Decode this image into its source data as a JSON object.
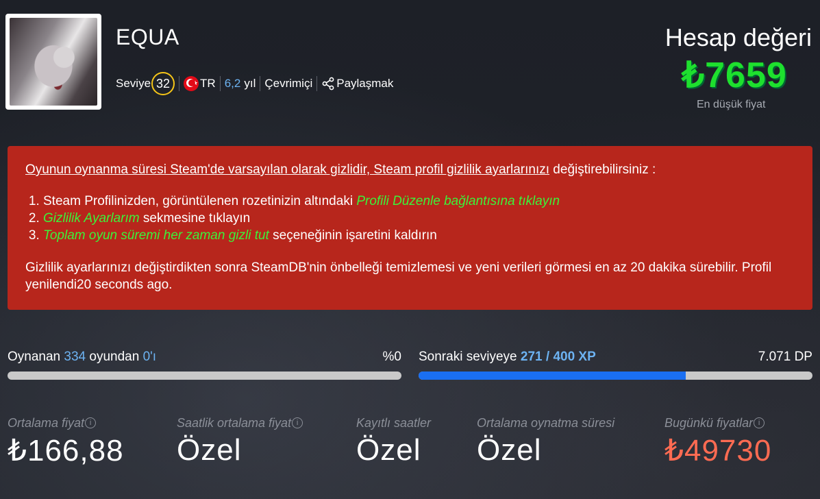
{
  "profile": {
    "username": "EQUA",
    "level_label": "Seviye",
    "level": "32",
    "country_code": "TR",
    "years": "6,2",
    "years_unit": "yıl",
    "status": "Çevrimiçi",
    "share_label": "Paylaşmak",
    "flag_icon": "turkey-flag-icon",
    "share_icon": "share-icon"
  },
  "account_value": {
    "title": "Hesap değeri",
    "price": "₺7659",
    "subtitle": "En düşük fiyat",
    "price_color": "#1ee02e"
  },
  "alert": {
    "background": "#b7261c",
    "heading_link": "Oyunun oynanma süresi Steam'de varsayılan olarak gizlidir, Steam profil gizlilik ayarlarınızı",
    "heading_rest": " değiştirebilirsiniz :",
    "steps": [
      {
        "before": "Steam Profilinizden, görüntülenen rozetinizin altındaki ",
        "highlight": "Profili Düzenle bağlantısına tıklayın",
        "after": ""
      },
      {
        "before": "",
        "highlight": "Gizlilik Ayarlarım",
        "after": " sekmesine tıklayın"
      },
      {
        "before": "",
        "highlight": "Toplam oyun süremi her zaman gizli tut",
        "after": " seçeneğinin işaretini kaldırın"
      }
    ],
    "footer": "Gizlilik ayarlarınızı değiştirdikten sonra SteamDB'nin önbelleği temizlemesi ve yeni verileri görmesi en az 20 dakika sürebilir. Profil yenilendi20 seconds ago."
  },
  "games_progress": {
    "prefix": "Oynanan ",
    "total": "334",
    "middle": " oyundan ",
    "played": "0'ı",
    "percent": "%0",
    "fraction": 0
  },
  "level_progress": {
    "prefix": "Sonraki seviyeye ",
    "xp": "271 / 400 XP",
    "dp": "7.071 DP",
    "fraction": 0.6775
  },
  "stats": [
    {
      "label": "Ortalama fiyat",
      "value": "₺166,88",
      "info": true
    },
    {
      "label": "Saatlik ortalama fiyat",
      "value": "Özel",
      "info": true
    },
    {
      "label": "Kayıtlı saatler",
      "value": "Özel",
      "info": false
    },
    {
      "label": "Ortalama oynatma süresi",
      "value": "Özel",
      "info": false
    },
    {
      "label": "Bugünkü fiyatlar",
      "value": "₺49730",
      "info": true
    }
  ],
  "info_icon": "info-icon",
  "colors": {
    "accent_blue": "#6db3f2",
    "progress_blue": "#1a6ff2",
    "highlight_green": "#3cf23a",
    "price_red": "#ff6b52",
    "level_ring": "#f5c518"
  }
}
